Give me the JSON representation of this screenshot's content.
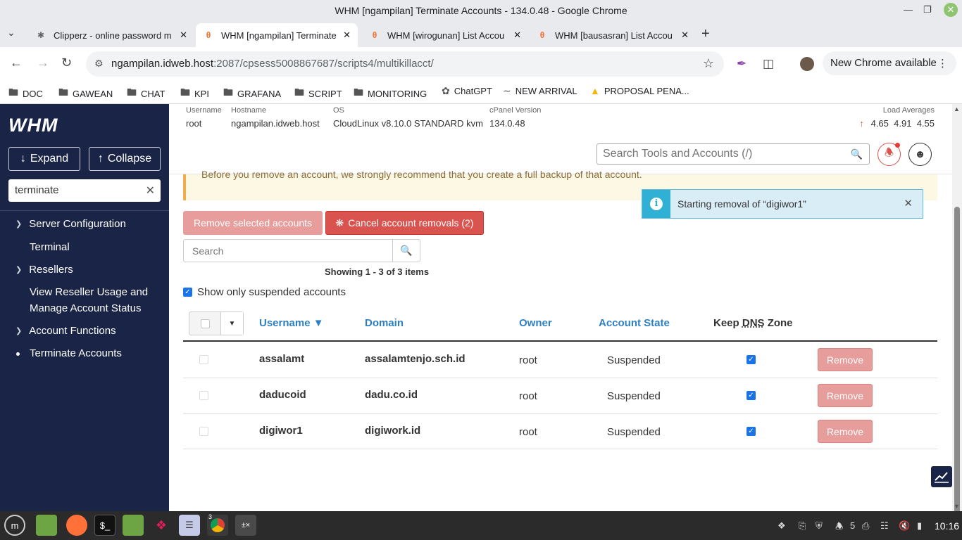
{
  "window": {
    "title": "WHM [ngampilan] Terminate Accounts - 134.0.48 - Google Chrome"
  },
  "tabs": [
    {
      "label": "Clipperz - online password m",
      "icon": "clipperz-star-icon"
    },
    {
      "label": "WHM [ngampilan] Terminate",
      "icon": "cpanel-icon"
    },
    {
      "label": "WHM [wirogunan] List Accou",
      "icon": "cpanel-icon"
    },
    {
      "label": "WHM [bausasran] List Accou",
      "icon": "cpanel-icon"
    }
  ],
  "address": {
    "host": "ngampilan.idweb.host",
    "path": ":2087/cpsess5008867687/scripts4/multikillacct/"
  },
  "new_chrome_label": "New Chrome available",
  "bookmarks": [
    {
      "label": "DOC",
      "icon": "folder-icon"
    },
    {
      "label": "GAWEAN",
      "icon": "folder-icon"
    },
    {
      "label": "CHAT",
      "icon": "folder-icon"
    },
    {
      "label": "KPI",
      "icon": "folder-icon"
    },
    {
      "label": "GRAFANA",
      "icon": "folder-icon"
    },
    {
      "label": "SCRIPT",
      "icon": "folder-icon"
    },
    {
      "label": "MONITORING",
      "icon": "folder-icon"
    },
    {
      "label": "ChatGPT",
      "icon": "chatgpt-icon"
    },
    {
      "label": "NEW ARRIVAL",
      "icon": "dash-icon"
    },
    {
      "label": "PROPOSAL PENA...",
      "icon": "drive-icon"
    }
  ],
  "sidebar": {
    "logo": "WHM",
    "expand_label": "Expand",
    "collapse_label": "Collapse",
    "filter_value": "terminate",
    "categories": [
      {
        "label": "Server Configuration",
        "items": [
          "Terminal"
        ]
      },
      {
        "label": "Resellers",
        "items": [
          "View Reseller Usage and Manage Account Status"
        ]
      },
      {
        "label": "Account Functions",
        "items": [
          "Terminate Accounts"
        ]
      }
    ]
  },
  "header": {
    "username_label": "Username",
    "username": "root",
    "hostname_label": "Hostname",
    "hostname": "ngampilan.idweb.host",
    "os_label": "OS",
    "os": "CloudLinux v8.10.0 STANDARD kvm",
    "cpanel_label": "cPanel Version",
    "cpanel_version": "134.0.48",
    "load_label": "Load Averages",
    "load": [
      "4.65",
      "4.91",
      "4.55"
    ],
    "search_placeholder": "Search Tools and Accounts (/)"
  },
  "content": {
    "warning_text": "Before you remove an account, we strongly recommend that you create a full backup of that account.",
    "remove_selected_label": "Remove selected accounts",
    "cancel_removals_label": "Cancel account removals (2)",
    "search_placeholder": "Search",
    "showing_text": "Showing 1 - 3 of 3 items",
    "show_suspended_label": "Show only suspended accounts",
    "columns": {
      "username": "Username ▼",
      "domain": "Domain",
      "owner": "Owner",
      "state": "Account State",
      "keep_dns_prefix": "Keep ",
      "keep_dns_abbr": "DNS",
      "keep_dns_suffix": " Zone"
    },
    "remove_label": "Remove",
    "rows": [
      {
        "username": "assalamt",
        "domain": "assalamtenjo.sch.id",
        "owner": "root",
        "state": "Suspended",
        "keep_dns": true
      },
      {
        "username": "daducoid",
        "domain": "dadu.co.id",
        "owner": "root",
        "state": "Suspended",
        "keep_dns": true
      },
      {
        "username": "digiwor1",
        "domain": "digiwork.id",
        "owner": "root",
        "state": "Suspended",
        "keep_dns": true
      }
    ]
  },
  "toast": {
    "message": "Starting removal of “digiwor1”"
  },
  "taskbar": {
    "chrome_badge": "3",
    "tray_count": "5",
    "clock": "10:16"
  },
  "colors": {
    "sidebar_bg": "#1a2447",
    "link_blue": "#2f7fc3",
    "danger": "#d9534f",
    "danger_light": "#e69d9b",
    "info": "#31b0d5"
  }
}
